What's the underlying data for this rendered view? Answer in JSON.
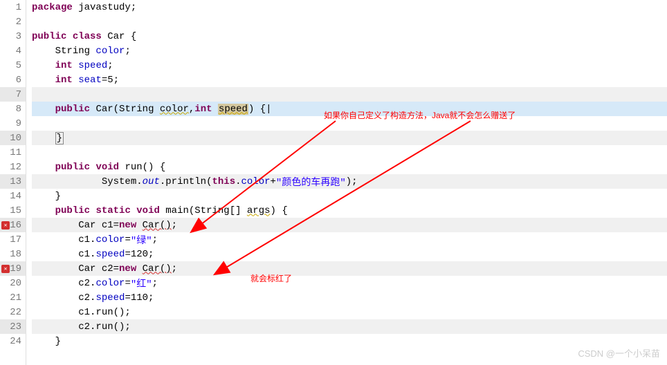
{
  "gutter": {
    "lines": [
      "1",
      "2",
      "3",
      "4",
      "5",
      "6",
      "7",
      "8",
      "9",
      "10",
      "11",
      "12",
      "13",
      "14",
      "15",
      "16",
      "17",
      "18",
      "19",
      "20",
      "21",
      "22",
      "23",
      "24"
    ],
    "highlighted": [
      7,
      10,
      13,
      16,
      19,
      23
    ],
    "errors": [
      16,
      19
    ]
  },
  "code": {
    "l1": {
      "kw1": "package",
      "rest": " javastudy;"
    },
    "l3": {
      "kw1": "public",
      "kw2": "class",
      "name": " Car {"
    },
    "l4": {
      "indent": "    ",
      "text": "String ",
      "field": "color",
      "semi": ";"
    },
    "l5": {
      "indent": "    ",
      "kw": "int",
      "sp": " ",
      "field": "speed",
      "semi": ";"
    },
    "l6": {
      "indent": "    ",
      "kw": "int",
      "sp": " ",
      "field": "seat",
      "rest": "=5;"
    },
    "l8": {
      "indent": "    ",
      "kw1": "public",
      "sp1": " ",
      "name": "Car",
      "open": "(String ",
      "p1": "color",
      "comma": ",",
      "kw2": "int",
      "sp2": " ",
      "p2": "speed",
      "close": ") {"
    },
    "l10": {
      "indent": "    ",
      "brace": "}"
    },
    "l12": {
      "indent": "    ",
      "kw1": "public",
      "sp1": " ",
      "kw2": "void",
      "name": " run() {"
    },
    "l13": {
      "indent": "            ",
      "sys": "System.",
      "out": "out",
      "dot": ".println(",
      "kw": "this",
      "dot2": ".",
      "fld": "color",
      "plus": "+",
      "str": "\"颜色的车再跑\"",
      "end": ");"
    },
    "l14": {
      "indent": "    ",
      "brace": "}"
    },
    "l15": {
      "indent": "    ",
      "kw1": "public",
      "sp1": " ",
      "kw2": "static",
      "sp2": " ",
      "kw3": "void",
      "name": " main(String[] ",
      "args": "args",
      "close": ") {"
    },
    "l16": {
      "indent": "        ",
      "type": "Car c1=",
      "kw": "new",
      "sp": " ",
      "call": "Car()",
      "semi": ";"
    },
    "l17": {
      "indent": "        ",
      "var": "c1.",
      "fld": "color",
      "eq": "=",
      "str": "\"绿\"",
      "semi": ";"
    },
    "l18": {
      "indent": "        ",
      "var": "c1.",
      "fld": "speed",
      "eq": "=120;"
    },
    "l19": {
      "indent": "        ",
      "type": "Car c2=",
      "kw": "new",
      "sp": " ",
      "call": "Car()",
      "semi": ";"
    },
    "l20": {
      "indent": "        ",
      "var": "c2.",
      "fld": "color",
      "eq": "=",
      "str": "\"红\"",
      "semi": ";"
    },
    "l21": {
      "indent": "        ",
      "var": "c2.",
      "fld": "speed",
      "eq": "=110;"
    },
    "l22": {
      "indent": "        ",
      "var": "c1.run();"
    },
    "l23": {
      "indent": "        ",
      "var": "c2.run();"
    },
    "l24": {
      "indent": "    ",
      "brace": "}"
    }
  },
  "annotations": {
    "a1": "如果你自己定义了构造方法，Java就不会怎么赠送了",
    "a2": "就会标红了"
  },
  "watermark": "CSDN @一个小呆苗"
}
